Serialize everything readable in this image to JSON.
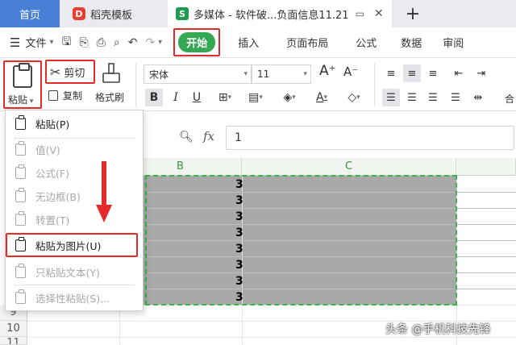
{
  "tabs": {
    "home": "首页",
    "template": "稻壳模板",
    "template_logo": "D",
    "document": "多媒体 - 软件破...负面信息11.21",
    "document_logo": "S",
    "new_tab": "+"
  },
  "menu": {
    "file": "文件",
    "start": "开始",
    "items": [
      "插入",
      "页面布局",
      "公式",
      "数据",
      "审阅"
    ]
  },
  "ribbon": {
    "paste": "粘贴",
    "cut": "剪切",
    "copy": "复制",
    "format_painter": "格式刷",
    "font_name": "宋体",
    "font_size": "11",
    "font_grow": "A⁺",
    "font_shrink": "A⁻",
    "bold": "B",
    "italic": "I",
    "underline": "U",
    "merge_label": "合"
  },
  "formula_bar": {
    "fx": "fx",
    "value": "1"
  },
  "grid": {
    "columns": [
      "B",
      "C"
    ],
    "rows": [
      "9",
      "10",
      "11"
    ],
    "cell_values": [
      "3",
      "3",
      "3",
      "3",
      "3",
      "3",
      "3",
      "3"
    ]
  },
  "paste_menu": {
    "items": [
      {
        "label": "粘贴(P)",
        "enabled": true
      },
      {
        "label": "值(V)",
        "enabled": false
      },
      {
        "label": "公式(F)",
        "enabled": false
      },
      {
        "label": "无边框(B)",
        "enabled": false
      },
      {
        "label": "转置(T)",
        "enabled": false
      },
      {
        "label": "粘贴为图片(U)",
        "enabled": true
      },
      {
        "label": "只粘贴文本(Y)",
        "enabled": false
      },
      {
        "label": "选择性粘贴(S)...",
        "enabled": false
      }
    ]
  },
  "watermark": "头条 @手机科技先锋",
  "colors": {
    "accent_red": "#e52a2a",
    "start_green": "#34a853",
    "selection_gray": "#a9a9a9",
    "marching_ants": "#39b54a"
  }
}
